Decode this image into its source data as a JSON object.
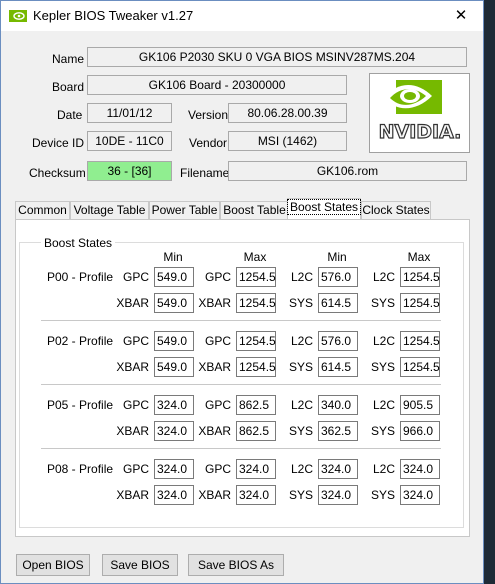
{
  "window": {
    "title": "Kepler BIOS Tweaker v1.27",
    "close_glyph": "✕"
  },
  "info": {
    "name_label": "Name",
    "name_value": "GK106 P2030 SKU 0 VGA BIOS MSINV287MS.204",
    "board_label": "Board",
    "board_value": "GK106 Board - 20300000",
    "date_label": "Date",
    "date_value": "11/01/12",
    "version_label": "Version",
    "version_value": "80.06.28.00.39",
    "device_label": "Device ID",
    "device_value": "10DE - 11C0",
    "vendor_label": "Vendor",
    "vendor_value": "MSI (1462)",
    "checksum_label": "Checksum",
    "checksum_value": "36 - [36]",
    "filename_label": "Filename",
    "filename_value": "GK106.rom"
  },
  "logo": {
    "icon": "nvidia-logo",
    "text": "NVIDIA."
  },
  "tabs": [
    "Common",
    "Voltage Table",
    "Power Table",
    "Boost Table",
    "Boost States",
    "Clock States"
  ],
  "boost": {
    "title": "Boost States",
    "headers": [
      "Min",
      "Max",
      "Min",
      "Max"
    ],
    "profiles": [
      {
        "name": "P00 - Profile",
        "row1": {
          "l1": "GPC",
          "v1": "549.0",
          "l2": "GPC",
          "v2": "1254.5",
          "l3": "L2C",
          "v3": "576.0",
          "l4": "L2C",
          "v4": "1254.5"
        },
        "row2": {
          "l1": "XBAR",
          "v1": "549.0",
          "l2": "XBAR",
          "v2": "1254.5",
          "l3": "SYS",
          "v3": "614.5",
          "l4": "SYS",
          "v4": "1254.5"
        }
      },
      {
        "name": "P02 - Profile",
        "row1": {
          "l1": "GPC",
          "v1": "549.0",
          "l2": "GPC",
          "v2": "1254.5",
          "l3": "L2C",
          "v3": "576.0",
          "l4": "L2C",
          "v4": "1254.5"
        },
        "row2": {
          "l1": "XBAR",
          "v1": "549.0",
          "l2": "XBAR",
          "v2": "1254.5",
          "l3": "SYS",
          "v3": "614.5",
          "l4": "SYS",
          "v4": "1254.5"
        }
      },
      {
        "name": "P05 - Profile",
        "row1": {
          "l1": "GPC",
          "v1": "324.0",
          "l2": "GPC",
          "v2": "862.5",
          "l3": "L2C",
          "v3": "340.0",
          "l4": "L2C",
          "v4": "905.5"
        },
        "row2": {
          "l1": "XBAR",
          "v1": "324.0",
          "l2": "XBAR",
          "v2": "862.5",
          "l3": "SYS",
          "v3": "362.5",
          "l4": "SYS",
          "v4": "966.0"
        }
      },
      {
        "name": "P08 - Profile",
        "row1": {
          "l1": "GPC",
          "v1": "324.0",
          "l2": "GPC",
          "v2": "324.0",
          "l3": "L2C",
          "v3": "324.0",
          "l4": "L2C",
          "v4": "324.0"
        },
        "row2": {
          "l1": "XBAR",
          "v1": "324.0",
          "l2": "XBAR",
          "v2": "324.0",
          "l3": "SYS",
          "v3": "324.0",
          "l4": "SYS",
          "v4": "324.0"
        }
      }
    ]
  },
  "buttons": {
    "open": "Open BIOS",
    "save": "Save BIOS",
    "save_as": "Save BIOS As"
  }
}
